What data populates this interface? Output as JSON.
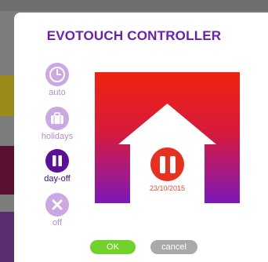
{
  "dialog": {
    "title": "EVOTOUCH CONTROLLER"
  },
  "modes": [
    {
      "label": "auto",
      "icon": "clock-icon",
      "active": false
    },
    {
      "label": "holidays",
      "icon": "suitcase-icon",
      "active": false
    },
    {
      "label": "day-off",
      "icon": "pause-icon",
      "active": true
    },
    {
      "label": "off",
      "icon": "close-icon",
      "active": false
    }
  ],
  "status": {
    "icon": "pause-icon",
    "date": "23/10/2015"
  },
  "buttons": {
    "ok_label": "OK",
    "cancel_label": "cancel"
  },
  "colors": {
    "accent": "#6a1fb5",
    "mode_inactive": "#cba8e3",
    "mode_active": "#5b0f9a",
    "ok": "#6fd12a",
    "cancel": "#a9a9a9",
    "gradient_top": "#f0230f",
    "gradient_bottom": "#7a18b8"
  }
}
